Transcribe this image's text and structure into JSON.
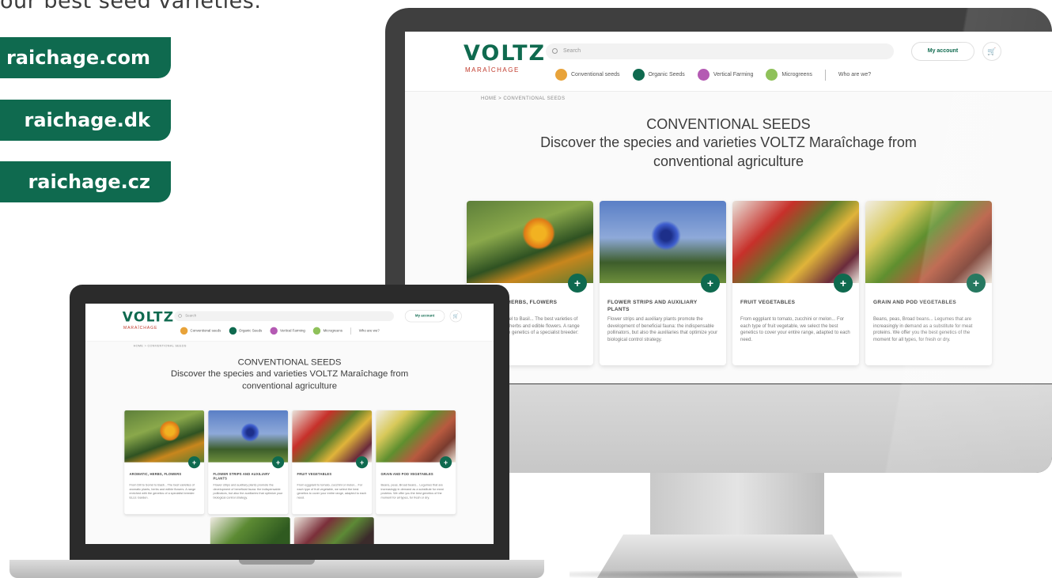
{
  "promo": {
    "text": "our best seed varieties.",
    "domains": [
      "raichage.com",
      "raichage.dk",
      "raichage.cz"
    ]
  },
  "site": {
    "logo": "VOLTZ",
    "logo_sub": "MARAÎCHAGE",
    "search_placeholder": "Search",
    "account_label": "My account",
    "cart_icon": "cart-icon",
    "nav": [
      {
        "label": "Conventional seeds",
        "color": "#e8a33a"
      },
      {
        "label": "Organic Seeds",
        "color": "#0f6a4f"
      },
      {
        "label": "Vertical Farming",
        "color": "#b45ab3"
      },
      {
        "label": "Microgreens",
        "color": "#8fc15a"
      }
    ],
    "nav_extra": "Who are we?",
    "breadcrumb": "HOME > CONVENTIONAL SEEDS",
    "title": "CONVENTIONAL SEEDS",
    "subtitle": "Discover the species and varieties VOLTZ Maraîchage from conventional agriculture",
    "cards": [
      {
        "title": "AROMATIC, HERBS, FLOWERS",
        "text": "From Dill to Sorrel to Basil... The best varieties of aromatic plants, herbs and edible flowers. A range enriched with the genetics of a specialist breeder: ELLE Garden."
      },
      {
        "title": "FLOWER STRIPS AND AUXILIARY PLANTS",
        "text": "Flower strips and auxiliary plants promote the development of beneficial fauna: the indispensable pollinators, but also the auxiliaries that optimize your biological control strategy."
      },
      {
        "title": "FRUIT VEGETABLES",
        "text": "From eggplant to tomato, zucchini or melon... For each type of fruit vegetable, we select the best genetics to cover your entire range, adapted to each need."
      },
      {
        "title": "GRAIN AND POD VEGETABLES",
        "text": "Beans, peas, Broad beans... Legumes that are increasingly in demand as a substitute for meat proteins. We offer you the best genetics of the moment for all types, for fresh or dry."
      }
    ],
    "card_plus": "+"
  }
}
